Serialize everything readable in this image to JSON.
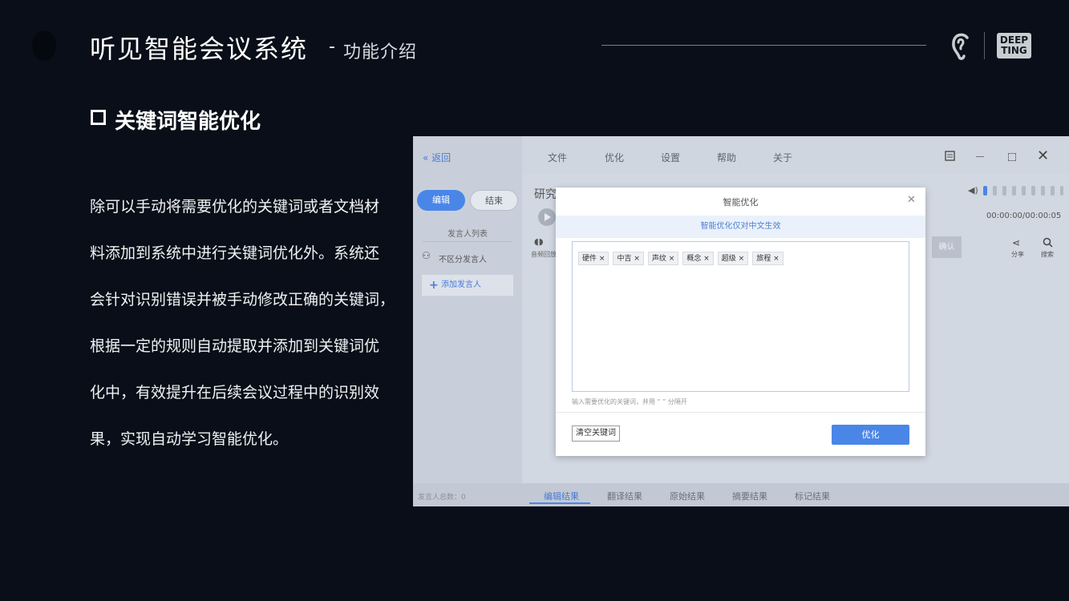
{
  "header": {
    "title": "听见智能会议系统",
    "separator": "-",
    "subtitle": "功能介绍",
    "brand_logo_line1": "DEEP",
    "brand_logo_line2": "TING"
  },
  "section": {
    "title": "关键词智能优化"
  },
  "paragraph_lines": [
    "除可以手动将需要优化的关键词或者文档材",
    "料添加到系统中进行关键词优化外。系统还",
    "会针对识别错误并被手动修改正确的关键词，",
    "根据一定的规则自动提取并添加到关键词优",
    "化中，有效提升在后续会议过程中的识别效",
    "果，实现自动学习智能优化。"
  ],
  "screenshot": {
    "back_label": "返回",
    "menu": [
      "文件",
      "优化",
      "设置",
      "帮助",
      "关于"
    ],
    "edit_button": "编辑",
    "end_button": "结束",
    "speaker_list_title": "发言人列表",
    "no_speaker": "不区分发言人",
    "add_speaker": "添加发言人",
    "doc_title_partial": "研究",
    "timer": "00:00:00/00:00:05",
    "tool_left_label": "音频回放",
    "confirm_label": "确认",
    "share_label": "分享",
    "search_label": "搜索",
    "speaker_count": "发言人总数：0",
    "bottom_tabs": [
      "编辑结果",
      "翻译结果",
      "原始结果",
      "摘要结果",
      "标记结果"
    ],
    "modal": {
      "title": "智能优化",
      "note": "智能优化仅对中文生效",
      "keywords": [
        "硬件",
        "中吉",
        "声纹",
        "概念",
        "超级",
        "旅程"
      ],
      "hint": "输入需要优化的关键词，并用 “ ” 分隔开",
      "clear_button": "清空关键词",
      "optimize_button": "优化"
    }
  },
  "colors": {
    "background": "#090e18",
    "accent_blue": "#4a86e8"
  }
}
